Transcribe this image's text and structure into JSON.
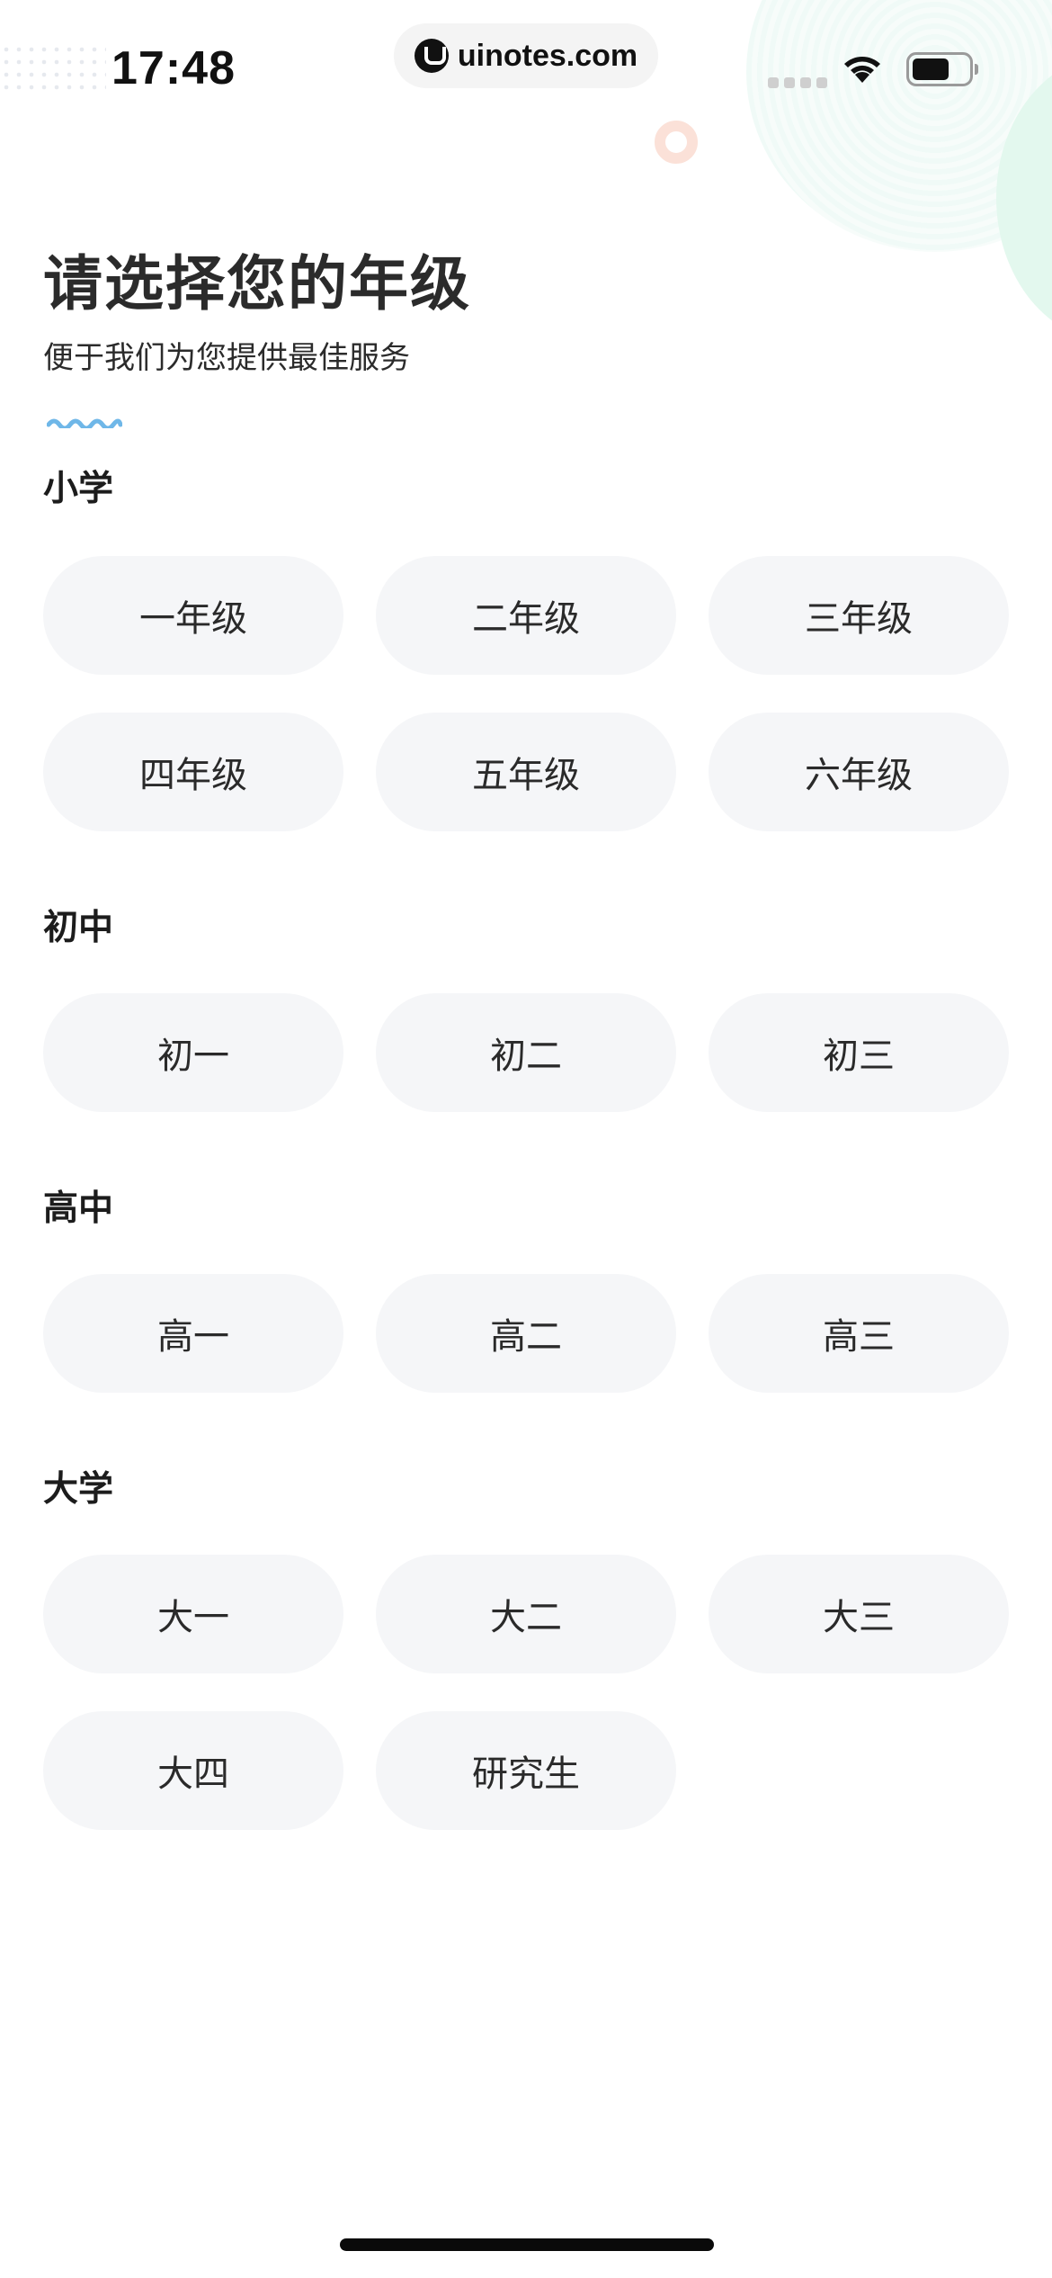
{
  "status_bar": {
    "time": "17:48",
    "url": "uinotes.com",
    "icons": [
      "signal-icon",
      "wifi-icon",
      "battery-icon"
    ]
  },
  "header": {
    "title": "请选择您的年级",
    "subtitle": "便于我们为您提供最佳服务"
  },
  "sections": {
    "primary": {
      "title": "小学",
      "grades": [
        "一年级",
        "二年级",
        "三年级",
        "四年级",
        "五年级",
        "六年级"
      ]
    },
    "junior": {
      "title": "初中",
      "grades": [
        "初一",
        "初二",
        "初三"
      ]
    },
    "senior": {
      "title": "高中",
      "grades": [
        "高一",
        "高二",
        "高三"
      ]
    },
    "university": {
      "title": "大学",
      "grades": [
        "大一",
        "大二",
        "大三",
        "大四",
        "研究生"
      ]
    }
  },
  "colors": {
    "button_bg": "#f5f6f8",
    "text": "#2a2a2a",
    "accent_wave": "#6fb7e8",
    "deco_ring": "#fbe1d8",
    "deco_green": "#e3f8ee"
  }
}
